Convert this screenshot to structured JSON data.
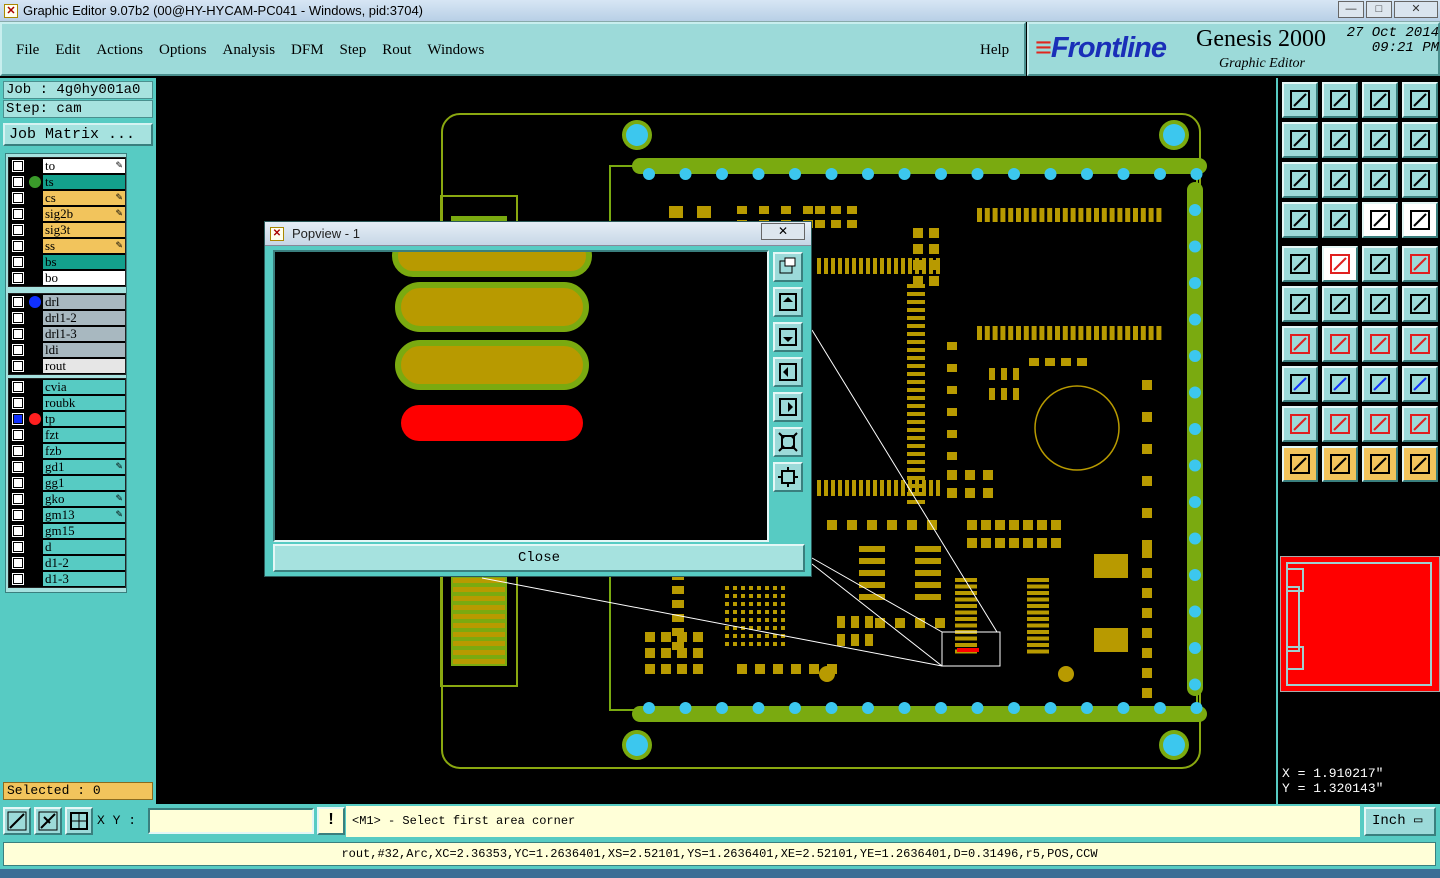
{
  "window": {
    "title": "Graphic Editor 9.07b2 (00@HY-HYCAM-PC041 - Windows, pid:3704)",
    "controls": {
      "minimize": "—",
      "maximize": "□",
      "close": "✕"
    }
  },
  "menu": {
    "items": [
      "File",
      "Edit",
      "Actions",
      "Options",
      "Analysis",
      "DFM",
      "Step",
      "Rout",
      "Windows"
    ],
    "help": "Help"
  },
  "brand": {
    "logo": "Frontline",
    "product": "Genesis 2000",
    "subtitle": "Graphic Editor",
    "date": "27 Oct 2014",
    "time": "09:21 PM"
  },
  "job": {
    "job_line": "Job : 4g0hy001a0",
    "step_line": "Step: cam",
    "matrix_button": "Job Matrix ..."
  },
  "layers": {
    "group1": [
      {
        "name": "to",
        "color": "#ffffff",
        "dot": "",
        "edit": true
      },
      {
        "name": "ts",
        "color": "#13a08c",
        "dot": "#3a9a2a",
        "edit": false
      },
      {
        "name": "cs",
        "color": "#f2c45c",
        "dot": "",
        "edit": true
      },
      {
        "name": "sig2b",
        "color": "#f2c45c",
        "dot": "",
        "edit": true
      },
      {
        "name": "sig3t",
        "color": "#f2c45c",
        "dot": "",
        "edit": false
      },
      {
        "name": "ss",
        "color": "#f2c45c",
        "dot": "",
        "edit": true
      },
      {
        "name": "bs",
        "color": "#13a08c",
        "dot": "",
        "edit": false
      },
      {
        "name": "bo",
        "color": "#ffffff",
        "dot": "",
        "edit": false
      }
    ],
    "group2": [
      {
        "name": "drl",
        "color": "#a8b8c0",
        "dot": "#1030ff",
        "edit": false
      },
      {
        "name": "drl1-2",
        "color": "#a8b8c0",
        "dot": "",
        "edit": false
      },
      {
        "name": "drl1-3",
        "color": "#a8b8c0",
        "dot": "",
        "edit": false
      },
      {
        "name": "ldi",
        "color": "#a8b8c0",
        "dot": "",
        "edit": false
      },
      {
        "name": "rout",
        "color": "#e6e6e6",
        "dot": "",
        "edit": false
      }
    ],
    "group3": [
      {
        "name": "cvia",
        "color": "#57cbc3",
        "dot": "",
        "edit": false
      },
      {
        "name": "roubk",
        "color": "#57cbc3",
        "dot": "",
        "edit": false
      },
      {
        "name": "tp",
        "color": "#57cbc3",
        "dot": "#ff2020",
        "edit": false,
        "active": true
      },
      {
        "name": "fzt",
        "color": "#57cbc3",
        "dot": "",
        "edit": false
      },
      {
        "name": "fzb",
        "color": "#57cbc3",
        "dot": "",
        "edit": false
      },
      {
        "name": "gd1",
        "color": "#57cbc3",
        "dot": "",
        "edit": true
      },
      {
        "name": "gg1",
        "color": "#57cbc3",
        "dot": "",
        "edit": false
      },
      {
        "name": "gko",
        "color": "#57cbc3",
        "dot": "",
        "edit": true
      },
      {
        "name": "gm13",
        "color": "#57cbc3",
        "dot": "",
        "edit": true
      },
      {
        "name": "gm15",
        "color": "#57cbc3",
        "dot": "",
        "edit": false
      },
      {
        "name": "d",
        "color": "#57cbc3",
        "dot": "",
        "edit": false
      },
      {
        "name": "d1-2",
        "color": "#57cbc3",
        "dot": "",
        "edit": false
      },
      {
        "name": "d1-3",
        "color": "#57cbc3",
        "dot": "",
        "edit": false
      }
    ]
  },
  "selected": "Selected : 0",
  "popview": {
    "title": "Popview - 1",
    "close_x": "✕",
    "close_button": "Close"
  },
  "coords": {
    "x": "X = 1.910217\"",
    "y": "Y = 1.320143\""
  },
  "status": {
    "xy_label": "X Y :",
    "xy_value": "",
    "alert": "!",
    "prompt": "<M1> - Select first area corner",
    "unit": "Inch",
    "message": "rout,#32,Arc,XC=2.36353,YC=1.2636401,XS=2.52101,YS=1.2636401,XE=2.52101,YE=1.2636401,D=0.31496,r5,POS,CCW"
  },
  "colors": {
    "panel": "#57cbc3",
    "button": "#9cdad9",
    "pad": "#b89a00",
    "copper_green": "#7aaa10",
    "via": "#3cc7ee",
    "highlight": "#ff0000"
  },
  "toolbar_icons": [
    "zoom-home-icon",
    "zoom-step-icon",
    "zoom-home2-icon",
    "zoom-window-icon",
    "pan-left-icon",
    "pan-right-icon",
    "zoom-reset-icon",
    "redraw-icon",
    "fit-all-icon",
    "fit-profile-icon",
    "scale-1-2-icon",
    "help-icon",
    "settings-icon",
    "grid-icon",
    "layer-colors-icon",
    "layer-colors-alt-icon",
    "snap-point-icon",
    "draw-line-icon",
    "ruler-icon",
    "dot-icon",
    "select-net-icon",
    "delete-icon",
    "move-icon",
    "copy-icon",
    "angle-icon",
    "line-red-icon",
    "rotate-icon",
    "mirror-icon",
    "connect-icon",
    "line-break-icon",
    "resize-icon",
    "group-icon",
    "measure-1-icon",
    "measure-2-icon",
    "measure-3-icon",
    "measure-4-icon",
    "pointer-icon",
    "pointer-box-icon",
    "pointer-circle-icon",
    "pointer-route-icon"
  ]
}
